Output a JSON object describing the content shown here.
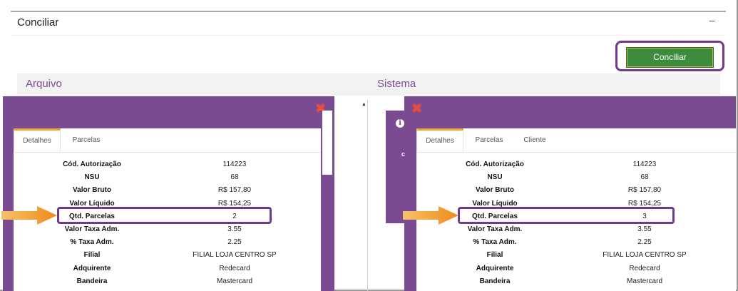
{
  "panel": {
    "title": "Conciliar",
    "collapse_symbol": "−"
  },
  "actions": {
    "conciliar_label": "Conciliar"
  },
  "columns": {
    "arquivo": "Arquivo",
    "sistema": "Sistema"
  },
  "icons": {
    "close": "✖",
    "info": "i",
    "scroll_up": "▲"
  },
  "colors": {
    "modal_purple": "#7b4b92",
    "highlight_purple": "#6d3a8e",
    "button_green": "#3d8b3d",
    "close_red": "#e74c3c",
    "arrow_orange": "#f5a623",
    "active_tab_orange": "#f0a028"
  },
  "background_fragment": {
    "right_letter": "c"
  },
  "left_modal": {
    "tabs": [
      "Detalhes",
      "Parcelas"
    ],
    "active_tab": "Detalhes",
    "rows": [
      {
        "label": "Cód. Autorização",
        "value": "114223"
      },
      {
        "label": "NSU",
        "value": "68"
      },
      {
        "label": "Valor Bruto",
        "value": "R$ 157,80"
      },
      {
        "label": "Valor Líquido",
        "value": "R$ 154,25"
      },
      {
        "label": "Qtd. Parcelas",
        "value": "2"
      },
      {
        "label": "Valor Taxa Adm.",
        "value": "3.55"
      },
      {
        "label": "% Taxa Adm.",
        "value": "2.25"
      },
      {
        "label": "Filial",
        "value": "FILIAL LOJA CENTRO SP"
      },
      {
        "label": "Adquirente",
        "value": "Redecard"
      },
      {
        "label": "Bandeira",
        "value": "Mastercard"
      }
    ]
  },
  "right_modal": {
    "tabs": [
      "Detalhes",
      "Parcelas",
      "Cliente"
    ],
    "active_tab": "Detalhes",
    "rows": [
      {
        "label": "Cód. Autorização",
        "value": "114223"
      },
      {
        "label": "NSU",
        "value": "68"
      },
      {
        "label": "Valor Bruto",
        "value": "R$ 157,80"
      },
      {
        "label": "Valor Líquido",
        "value": "R$ 154,25"
      },
      {
        "label": "Qtd. Parcelas",
        "value": "3"
      },
      {
        "label": "Valor Taxa Adm.",
        "value": "3.55"
      },
      {
        "label": "% Taxa Adm.",
        "value": "2.25"
      },
      {
        "label": "Filial",
        "value": "FILIAL LOJA CENTRO SP"
      },
      {
        "label": "Adquirente",
        "value": "Redecard"
      },
      {
        "label": "Bandeira",
        "value": "Mastercard"
      }
    ]
  }
}
